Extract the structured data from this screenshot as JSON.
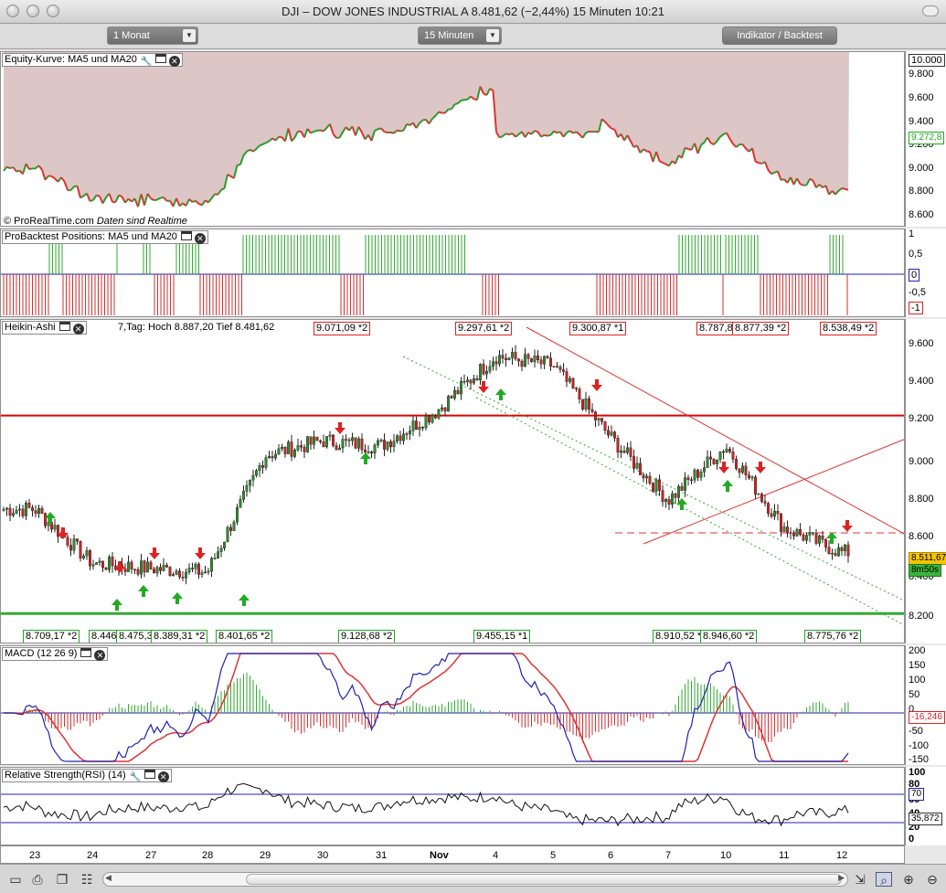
{
  "window": {
    "title": "DJI – DOW JONES INDUSTRIAL A    8.481,62 (−2,44%)    15 Minuten   10:21"
  },
  "toolbar": {
    "period_select": "1 Monat",
    "interval_select": "15 Minuten",
    "indicator_button": "Indikator / Backtest"
  },
  "equity": {
    "title": "Equity-Kurve: MA5 und MA20",
    "copyright": "© ProRealTime.com",
    "realtime_note": "Daten sind Realtime",
    "axis_labels": [
      "10.000",
      "9.800",
      "9.600",
      "9.400",
      "9.200",
      "9.000",
      "8.800",
      "8.600"
    ],
    "current_tag": "9.272,8"
  },
  "positions": {
    "title": "ProBacktest Positions: MA5 und MA20",
    "axis_labels": [
      "1",
      "0,5",
      "0",
      "-0,5",
      "-1"
    ]
  },
  "heikin": {
    "title": "Heikin-Ashi",
    "info_text": "7,Tag: Hoch 8.887,20 Tief 8.481,62",
    "high_labels": [
      "9.071,09 *2",
      "9.297,61 *2",
      "9.300,87 *1",
      "8.787,8",
      "8.877,39 *2",
      "8.538,49 *2"
    ],
    "low_labels": [
      "8.709,17 *2",
      "8.446",
      "8.475,3",
      "8.389,31 *2",
      "8.401,65 *2",
      "9.128,68 *2",
      "9.455,15 *1",
      "8.910,52 *",
      "8.946,60 *2",
      "8.775,76 *2"
    ],
    "axis_labels": [
      "9.600",
      "9.400",
      "9.200",
      "9.000",
      "8.800",
      "8.600",
      "8.400",
      "8.200"
    ],
    "price_tag": "8.511,67",
    "timer_tag": "8m50s"
  },
  "macd": {
    "title": "MACD (12 26 9)",
    "axis_labels": [
      "200",
      "150",
      "100",
      "50",
      "0",
      "-50",
      "-100",
      "-150"
    ],
    "value_tag": "-16,246"
  },
  "rsi": {
    "title": "Relative Strength(RSI) (14)",
    "axis_labels": [
      "100",
      "80",
      "60",
      "40",
      "20",
      "0"
    ],
    "upper_tag": "70",
    "value_tag": "35,872"
  },
  "xaxis": {
    "labels": [
      "23",
      "24",
      "27",
      "28",
      "29",
      "30",
      "31",
      "Nov",
      "4",
      "5",
      "6",
      "7",
      "10",
      "11",
      "12"
    ]
  },
  "chart_data": {
    "type": "line",
    "title": "DJI – DOW JONES INDUSTRIAL A",
    "x": [
      "23",
      "24",
      "27",
      "28",
      "29",
      "30",
      "31",
      "Nov",
      "4",
      "5",
      "6",
      "7",
      "10",
      "11",
      "12"
    ],
    "xlabel": "",
    "ylabel": "",
    "ylim": [
      8100,
      9700
    ],
    "series": [
      {
        "values": [
          8750,
          8450,
          8420,
          8400,
          9050,
          9130,
          9100,
          9300,
          9600,
          9550,
          9150,
          8800,
          9100,
          8650,
          8510
        ]
      }
    ],
    "horizontal_lines": [
      9270,
      8170
    ],
    "colors": {
      "up": "#2e8b2e",
      "down": "#cc2222",
      "resistance": "#dd0000",
      "support": "#33aa33"
    }
  },
  "bottombar": {
    "icons": [
      "print-icon",
      "copy-icon",
      "settings-icon",
      "zoom-icon"
    ]
  }
}
